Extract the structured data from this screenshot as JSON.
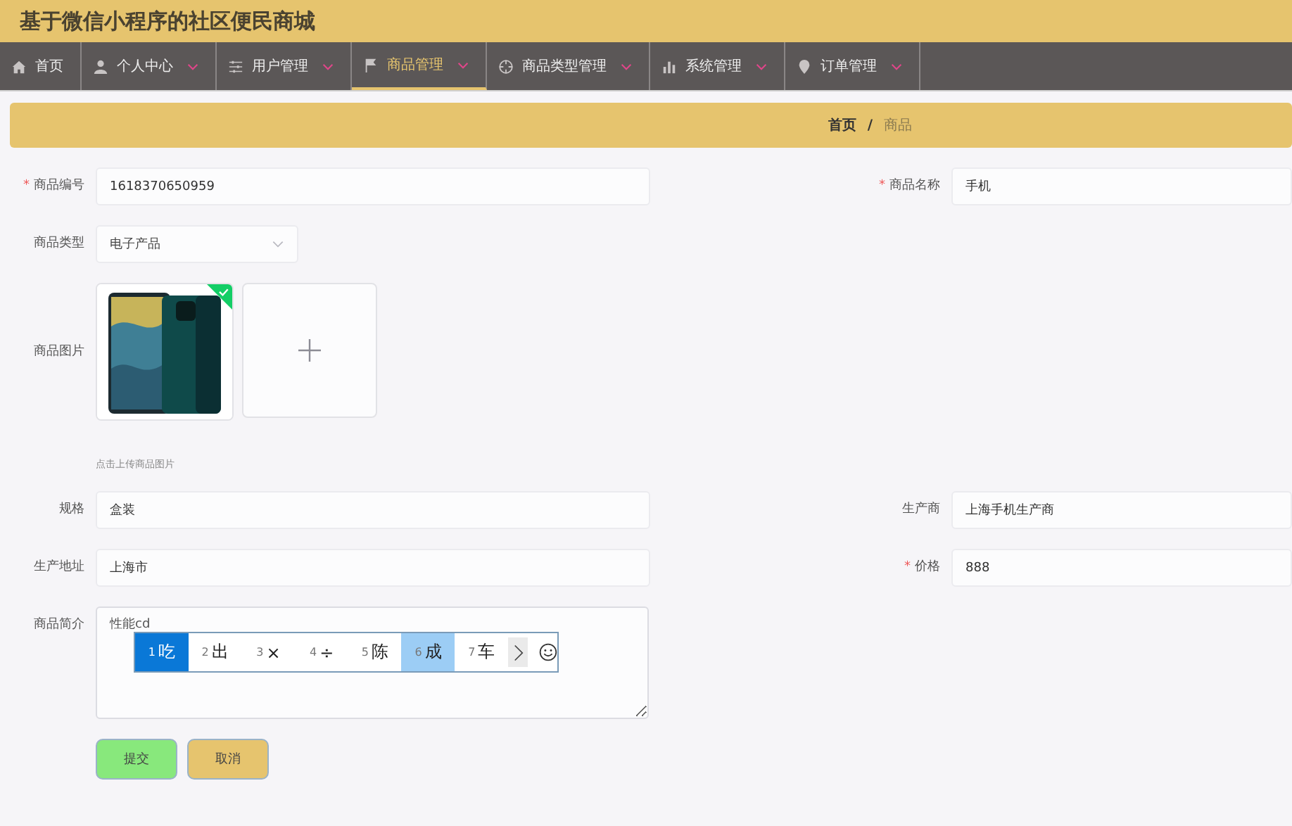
{
  "app_title": "基于微信小程序的社区便民商城",
  "nav": [
    {
      "label": "首页",
      "kind": "home",
      "has_menu": false,
      "selected": false
    },
    {
      "label": "个人中心",
      "kind": "person",
      "has_menu": true,
      "selected": false
    },
    {
      "label": "用户管理",
      "kind": "sliders",
      "has_menu": true,
      "selected": false
    },
    {
      "label": "商品管理",
      "kind": "flag",
      "has_menu": true,
      "selected": true
    },
    {
      "label": "商品类型管理",
      "kind": "target",
      "has_menu": true,
      "selected": false
    },
    {
      "label": "系统管理",
      "kind": "bars",
      "has_menu": true,
      "selected": false
    },
    {
      "label": "订单管理",
      "kind": "pin",
      "has_menu": true,
      "selected": false
    }
  ],
  "breadcrumb": [
    {
      "label": "首页",
      "current": false
    },
    {
      "label": "商品",
      "current": true
    }
  ],
  "breadcrumb_separator": "/",
  "fields": [
    {
      "kind": "text",
      "label": "商品编号",
      "required_mark": "*",
      "value": "1618370650959"
    },
    {
      "kind": "text",
      "label": "商品名称",
      "required_mark": "*",
      "value": "手机"
    },
    {
      "kind": "select",
      "label": "商品类型",
      "value": "电子产品"
    },
    {
      "kind": "upload",
      "label": "商品图片",
      "uploaded": true,
      "hint": "点击上传商品图片"
    },
    {
      "kind": "text",
      "label": "规格",
      "value": "盒装"
    },
    {
      "kind": "text",
      "label": "生产商",
      "value": "上海手机生产商"
    },
    {
      "kind": "text",
      "label": "生产地址",
      "value": "上海市"
    },
    {
      "kind": "text",
      "label": "价格",
      "required_mark": "*",
      "value": "888"
    },
    {
      "kind": "textarea",
      "label": "商品简介",
      "value": "性能cd"
    }
  ],
  "ime": {
    "candidates": [
      {
        "index": "1",
        "text": "吃",
        "selected": true,
        "highlighted": false
      },
      {
        "index": "2",
        "text": "出",
        "selected": false,
        "highlighted": false
      },
      {
        "index": "3",
        "text": "×",
        "selected": false,
        "highlighted": false
      },
      {
        "index": "4",
        "text": "÷",
        "selected": false,
        "highlighted": false
      },
      {
        "index": "5",
        "text": "陈",
        "selected": false,
        "highlighted": false
      },
      {
        "index": "6",
        "text": "成",
        "selected": false,
        "highlighted": true
      },
      {
        "index": "7",
        "text": "车",
        "selected": false,
        "highlighted": false
      }
    ]
  },
  "buttons": [
    {
      "label": "提交",
      "kind": "submit"
    },
    {
      "label": "取消",
      "kind": "cancel"
    }
  ]
}
